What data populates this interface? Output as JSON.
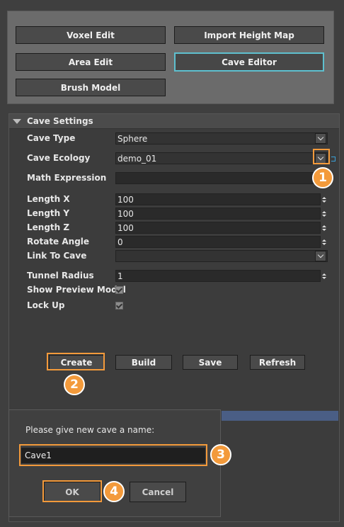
{
  "top_buttons": {
    "voxel_edit": "Voxel Edit",
    "import_height_map": "Import Height Map",
    "area_edit": "Area Edit",
    "cave_editor": "Cave Editor",
    "brush_model": "Brush Model"
  },
  "cave_settings": {
    "header": "Cave Settings",
    "cave_type_label": "Cave Type",
    "cave_type_value": "Sphere",
    "cave_ecology_label": "Cave Ecology",
    "cave_ecology_value": "demo_01",
    "math_expression_label": "Math Expression",
    "math_expression_value": "",
    "length_x_label": "Length X",
    "length_x_value": "100",
    "length_y_label": "Length Y",
    "length_y_value": "100",
    "length_z_label": "Length Z",
    "length_z_value": "100",
    "rotate_angle_label": "Rotate Angle",
    "rotate_angle_value": "0",
    "link_to_cave_label": "Link To Cave",
    "link_to_cave_value": "",
    "tunnel_radius_label": "Tunnel Radius",
    "tunnel_radius_value": "1",
    "show_preview_model_label": "Show Preview Model",
    "show_preview_model_checked": true,
    "lock_up_label": "Lock Up",
    "lock_up_checked": true
  },
  "actions": {
    "create": "Create",
    "build": "Build",
    "save": "Save",
    "refresh": "Refresh"
  },
  "dialog": {
    "prompt": "Please give new cave a name:",
    "name_value": "Cave1",
    "ok": "OK",
    "cancel": "Cancel"
  },
  "callouts": {
    "one": "1",
    "two": "2",
    "three": "3",
    "four": "4"
  },
  "colors": {
    "highlight": "#f39a3b",
    "active_border": "#5ec0cf"
  }
}
